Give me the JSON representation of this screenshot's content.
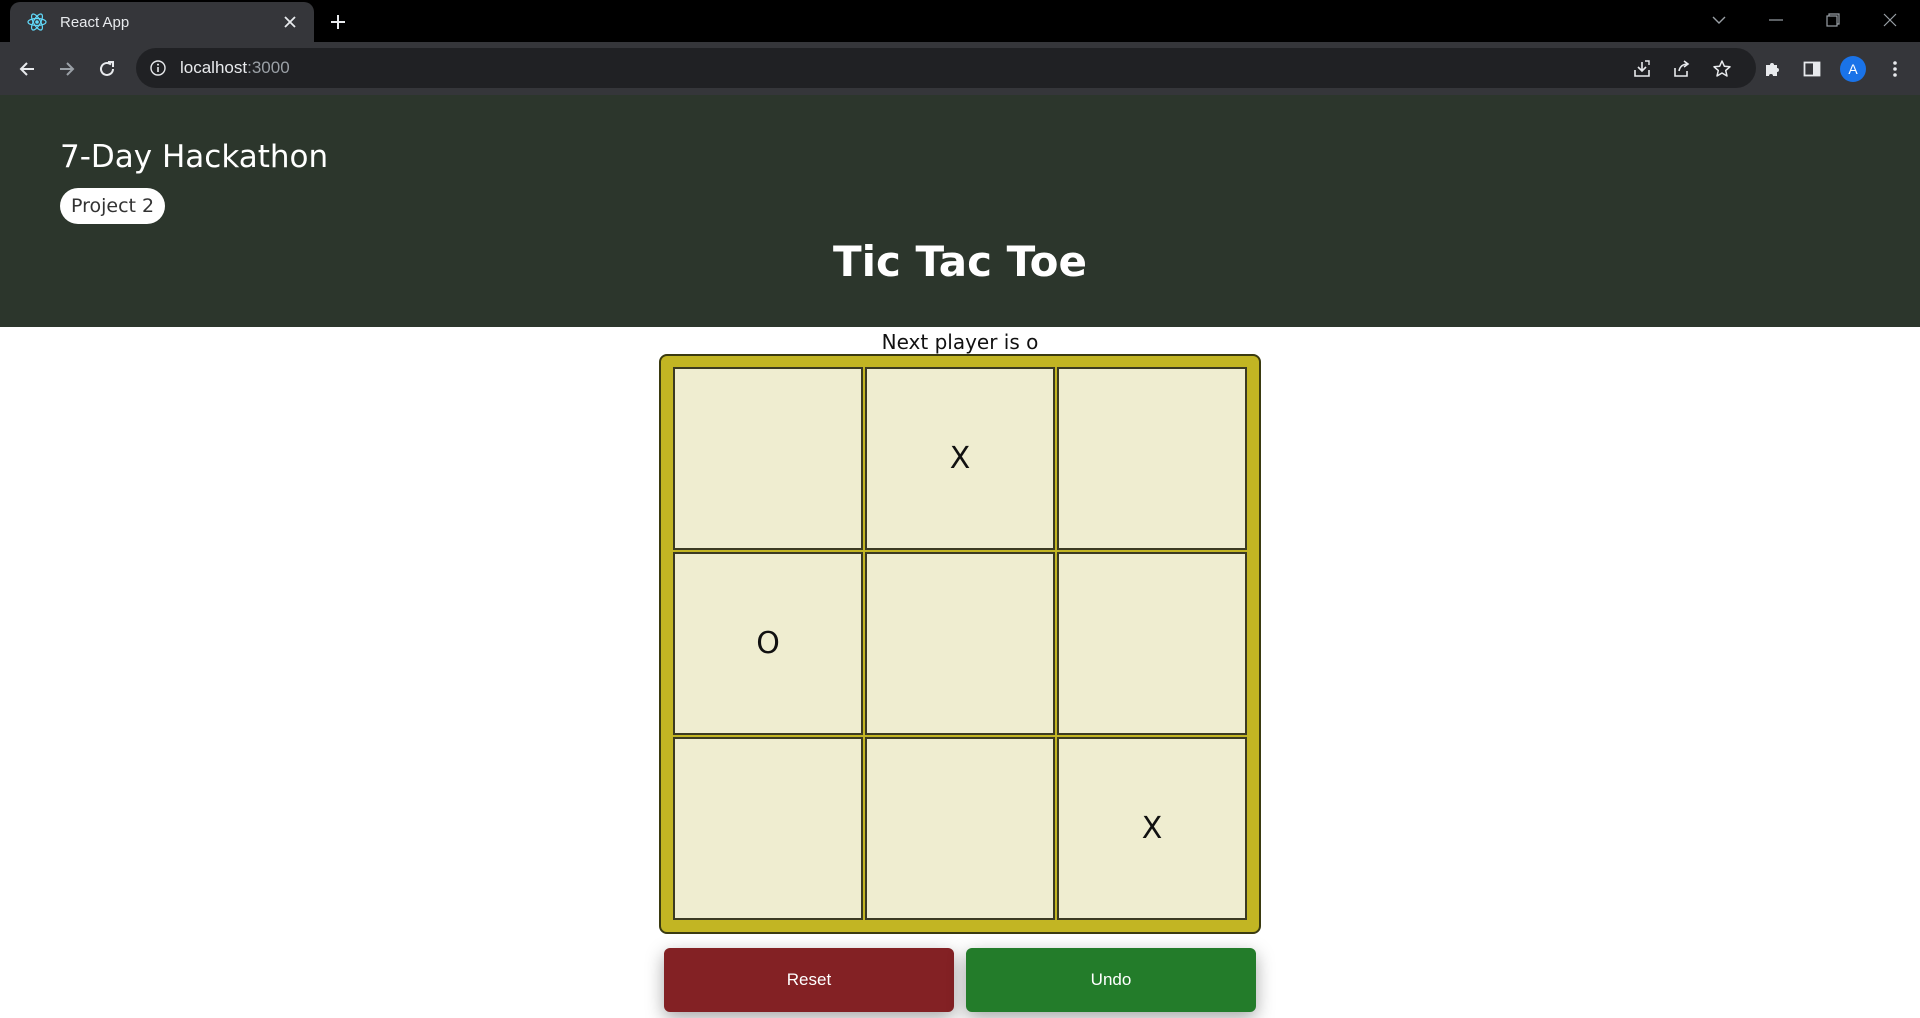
{
  "browser": {
    "tab_title": "React App",
    "url_host": "localhost",
    "url_port": ":3000",
    "avatar_letter": "A"
  },
  "header": {
    "brand": "7-Day Hackathon",
    "badge": "Project 2",
    "title": "Tic Tac Toe"
  },
  "game": {
    "status": "Next player is o",
    "cells": [
      "",
      "X",
      "",
      "O",
      "",
      "",
      "",
      "",
      "X"
    ]
  },
  "buttons": {
    "reset": "Reset",
    "undo": "Undo"
  },
  "colors": {
    "header_bg": "#2c362c",
    "board_bg": "#c2b523",
    "cell_bg": "#efedd0",
    "reset_bg": "#832124",
    "undo_bg": "#237c2a"
  },
  "icons": {
    "tab_favicon": "react-icon",
    "tab_close": "close-icon",
    "new_tab": "plus-icon",
    "back": "back-arrow-icon",
    "forward": "forward-arrow-icon",
    "reload": "reload-icon",
    "site_info": "info-icon",
    "install": "install-icon",
    "share": "share-icon",
    "bookmark": "star-icon",
    "extensions": "puzzle-icon",
    "side_panel": "side-panel-icon"
  }
}
